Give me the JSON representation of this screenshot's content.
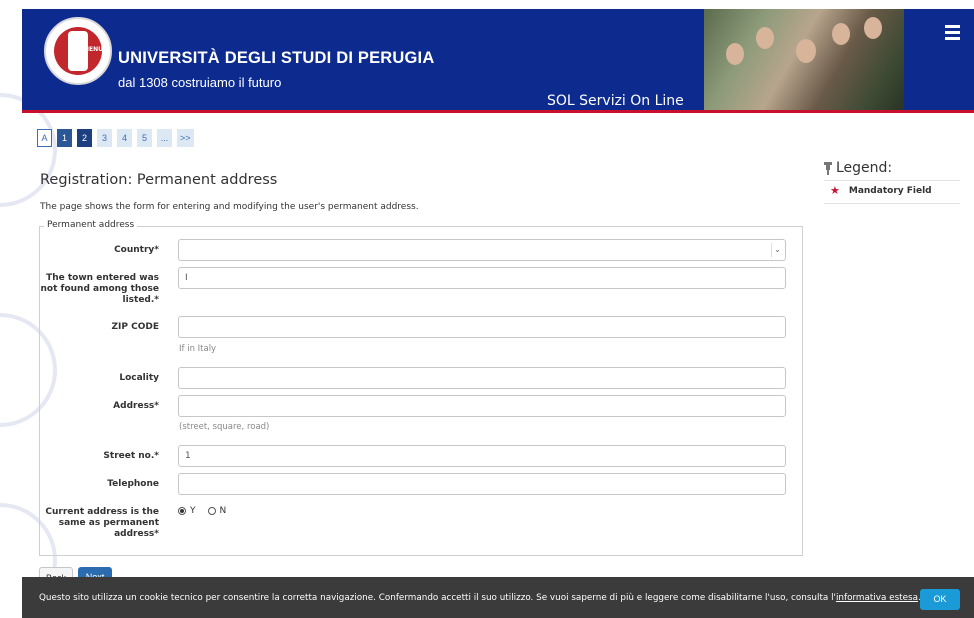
{
  "header": {
    "university": "UNIVERSITÀ DEGLI STUDI DI PERUGIA",
    "subtitle": "dal 1308 costruiamo il futuro",
    "service": "SOL Servizi On Line",
    "menu_label": "MENU",
    "menu_icon": "hamburger-icon"
  },
  "pager": [
    "A",
    "1",
    "2",
    "3",
    "4",
    "5",
    "...",
    ">>"
  ],
  "page": {
    "title": "Registration: Permanent address",
    "description": "The page shows the form for entering and modifying the user's permanent address."
  },
  "form": {
    "fieldset_legend": "Permanent address",
    "country_label": "Country*",
    "country_value": "",
    "town_label": "The town entered was not found among those listed.*",
    "town_value": "I",
    "zip_label": "ZIP CODE",
    "zip_value": "",
    "zip_hint": "If in Italy",
    "locality_label": "Locality",
    "locality_value": "",
    "address_label": "Address*",
    "address_value": "",
    "address_hint": "(street, square, road)",
    "street_no_label": "Street no.*",
    "street_no_value": "1",
    "telephone_label": "Telephone",
    "telephone_value": "",
    "current_label": "Current address is the same as permanent address*",
    "radio_yes": "Y",
    "radio_no": "N",
    "radio_selected": "Y"
  },
  "legend": {
    "title": "Legend:",
    "mandatory": "Mandatory Field",
    "mandatory_color": "#c8102e"
  },
  "buttons": {
    "back": "Back",
    "next": "Next"
  },
  "cookie": {
    "text": "Questo sito utilizza un cookie tecnico per consentire la corretta navigazione. Confermando accetti il suo utilizzo. Se vuoi saperne di più e leggere come disabilitarne l'uso, consulta l'",
    "link": "informativa estesa",
    "suffix": ".",
    "ok": "OK"
  },
  "colors": {
    "header_bg": "#0d2a8f",
    "accent_red": "#c8102e",
    "button_blue": "#2b6cb0",
    "cookie_bg": "#3b3b3b"
  }
}
